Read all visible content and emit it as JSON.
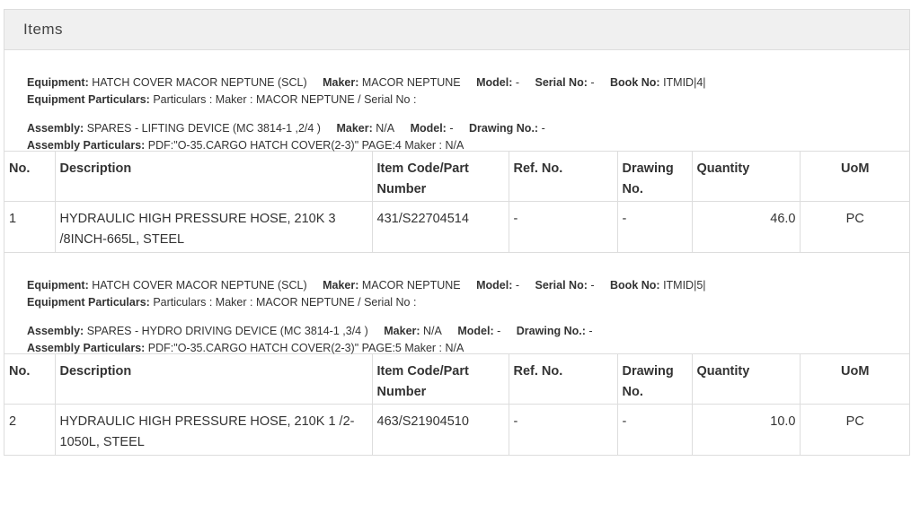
{
  "panel": {
    "title": "Items"
  },
  "columns": [
    "No.",
    "Description",
    "Item Code/Part Number",
    "Ref. No.",
    "Drawing No.",
    "Quantity",
    "UoM"
  ],
  "groups": [
    {
      "equipment": {
        "label": "Equipment:",
        "value": "HATCH COVER MACOR NEPTUNE (SCL)",
        "maker_label": "Maker:",
        "maker": "MACOR NEPTUNE",
        "model_label": "Model:",
        "model": "-",
        "serial_label": "Serial No:",
        "serial": "-",
        "book_label": "Book No:",
        "book": "ITMID|4|"
      },
      "equipment_particulars": {
        "label": "Equipment Particulars:",
        "value": "Particulars : Maker : MACOR NEPTUNE / Serial No :"
      },
      "assembly": {
        "label": "Assembly:",
        "value": "SPARES - LIFTING DEVICE (MC 3814-1 ,2/4 )",
        "maker_label": "Maker:",
        "maker": "N/A",
        "model_label": "Model:",
        "model": "-",
        "drawing_label": "Drawing No.:",
        "drawing": "-"
      },
      "assembly_particulars": {
        "label": "Assembly Particulars:",
        "value": "PDF:\"O-35.CARGO HATCH COVER(2-3)\" PAGE:4 Maker : N/A"
      },
      "row": {
        "no": "1",
        "description": "HYDRAULIC HIGH PRESSURE HOSE, 210K 3 /8INCH-665L, STEEL",
        "item_code": "431/S22704514",
        "ref_no": "-",
        "drawing_no": "-",
        "quantity": "46.0",
        "uom": "PC"
      }
    },
    {
      "equipment": {
        "label": "Equipment:",
        "value": "HATCH COVER MACOR NEPTUNE (SCL)",
        "maker_label": "Maker:",
        "maker": "MACOR NEPTUNE",
        "model_label": "Model:",
        "model": "-",
        "serial_label": "Serial No:",
        "serial": "-",
        "book_label": "Book No:",
        "book": "ITMID|5|"
      },
      "equipment_particulars": {
        "label": "Equipment Particulars:",
        "value": "Particulars : Maker : MACOR NEPTUNE / Serial No :"
      },
      "assembly": {
        "label": "Assembly:",
        "value": "SPARES - HYDRO DRIVING DEVICE (MC 3814-1 ,3/4 )",
        "maker_label": "Maker:",
        "maker": "N/A",
        "model_label": "Model:",
        "model": "-",
        "drawing_label": "Drawing No.:",
        "drawing": "-"
      },
      "assembly_particulars": {
        "label": "Assembly Particulars:",
        "value": "PDF:\"O-35.CARGO HATCH COVER(2-3)\" PAGE:5 Maker : N/A"
      },
      "row": {
        "no": "2",
        "description": "HYDRAULIC HIGH PRESSURE HOSE, 210K 1 /2-1050L, STEEL",
        "item_code": "463/S21904510",
        "ref_no": "-",
        "drawing_no": "-",
        "quantity": "10.0",
        "uom": "PC"
      }
    }
  ]
}
